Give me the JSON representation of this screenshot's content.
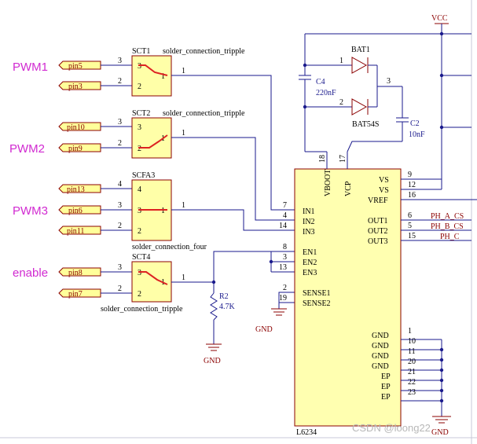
{
  "nets": {
    "pwm1": "PWM1",
    "pwm2": "PWM2",
    "pwm3": "PWM3",
    "enable": "enable",
    "vcc": "VCC",
    "gnd": "GND",
    "ph_a": "PH_A_CS",
    "ph_b": "PH_B_CS",
    "ph_c": "PH_C"
  },
  "ports": [
    "pin5",
    "pin3",
    "pin10",
    "pin9",
    "pin13",
    "pin6",
    "pin11",
    "pin8",
    "pin7"
  ],
  "switches": {
    "sct1": {
      "ref": "SCT1",
      "value": "solder_connection_tripple"
    },
    "sct2": {
      "ref": "SCT2",
      "value": "solder_connection_tripple"
    },
    "scfa3": {
      "ref": "SCFA3",
      "value": "solder_connection_four"
    },
    "sct4": {
      "ref": "SCT4",
      "value": "solder_connection_tripple"
    }
  },
  "pin_numbers": {
    "n1": "1",
    "n2": "2",
    "n3": "3",
    "n4": "4",
    "n5": "5",
    "n6": "6",
    "n7": "7",
    "n8": "8",
    "n9": "9",
    "n10": "10",
    "n11": "11",
    "n12": "12",
    "n13": "13",
    "n14": "14",
    "n15": "15",
    "n16": "16",
    "n17": "17",
    "n18": "18",
    "n19": "19",
    "n20": "20",
    "n21": "21",
    "n22": "22",
    "n23": "23"
  },
  "ic": {
    "ref": "L6234",
    "left_pins": [
      "IN1",
      "IN2",
      "IN3",
      "EN1",
      "EN2",
      "EN3",
      "SENSE1",
      "SENSE2"
    ],
    "right_pins": [
      "VS",
      "VS",
      "VREF",
      "OUT1",
      "OUT2",
      "OUT3",
      "GND",
      "GND",
      "GND",
      "GND",
      "EP",
      "EP",
      "EP"
    ],
    "top_pins": [
      "VBOOT",
      "VCP"
    ]
  },
  "components": {
    "bat1": {
      "ref": "BAT1",
      "value": "BAT54S"
    },
    "c4": {
      "ref": "C4",
      "value": "220nF"
    },
    "c2": {
      "ref": "C2",
      "value": "10nF"
    },
    "r2": {
      "ref": "R2",
      "value": "4.7K"
    }
  },
  "watermark": "CSDN @loong22"
}
